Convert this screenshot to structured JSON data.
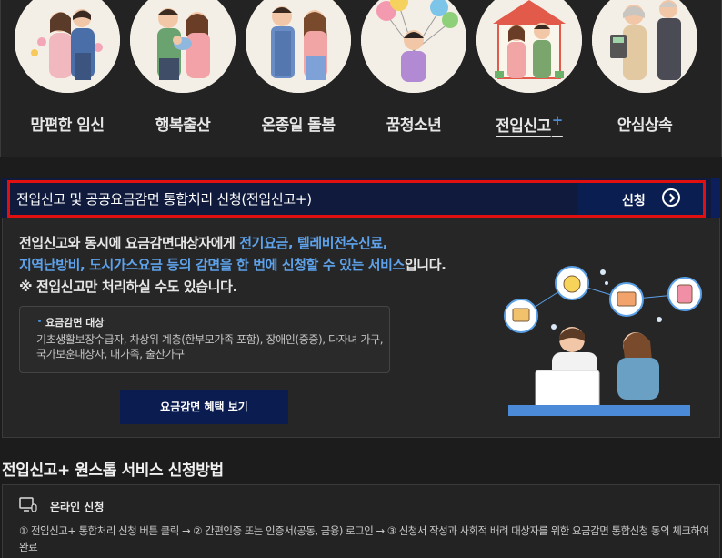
{
  "categories": [
    {
      "label": "맘편한 임신",
      "plus": ""
    },
    {
      "label": "행복출산",
      "plus": ""
    },
    {
      "label": "온종일 돌봄",
      "plus": ""
    },
    {
      "label": "꿈청소년",
      "plus": ""
    },
    {
      "label": "전입신고",
      "plus": "+"
    },
    {
      "label": "안심상속",
      "plus": ""
    }
  ],
  "banner": {
    "title": "전입신고 및 공공요금감면 통합처리 신청(전입신고+)",
    "apply_label": "신청"
  },
  "description": {
    "part1": "전입신고와 동시에 요금감면대상자에게 ",
    "hl1": "전기요금, 텔레비전수신료,",
    "hl2": "지역난방비, 도시가스요금 등의 감면을 한 번에 신청할 수 있는 서비스",
    "part2": "입니다.",
    "note": "※ 전입신고만 처리하실 수도 있습니다."
  },
  "info_box": {
    "title": "요금감면 대상",
    "body": "기초생활보장수급자, 차상위 계층(한부모가족 포함), 장애인(중증), 다자녀 가구, 국가보훈대상자, 대가족, 출산가구"
  },
  "benefit_button": "요금감면 혜택 보기",
  "method": {
    "title": "전입신고+ 원스톱 서비스 신청방법",
    "online_title": "온라인 신청",
    "online_body": "① 전입신고+ 통합처리 신청 버튼 클릭 → ② 간편인증 또는 인증서(공동, 금융) 로그인 → ③ 신청서 작성과 사회적 배려 대상자를 위한 요금감면 통합신청 동의 체크하여 완료"
  },
  "colors": {
    "background": "#1c1c1c",
    "banner_bg": "#0f1a3c",
    "highlight_text": "#5da2ea",
    "outline_red": "#e01010",
    "button_navy": "#0b1d50"
  },
  "icons": [
    "chevron-right-icon",
    "computer-mouse-icon"
  ]
}
